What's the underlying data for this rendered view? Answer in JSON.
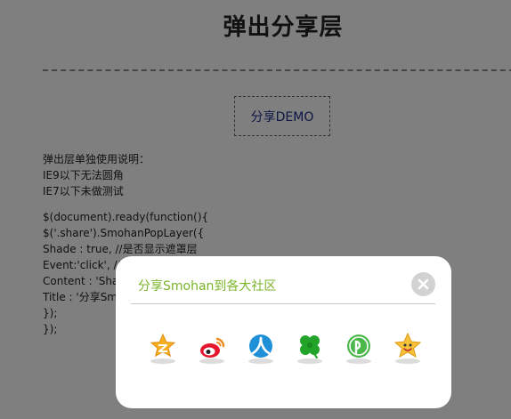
{
  "page": {
    "title": "弹出分享层",
    "demo_button_label": "分享DEMO"
  },
  "notes": [
    "弹出层单独使用说明：",
    "IE9以下无法圆角",
    "IE7以下未做测试"
  ],
  "code": [
    "$(document).ready(function(){",
    "$('.share').SmohanPopLayer({",
    "Shade : true, //是否显示遮罩层",
    "Event:'click', //",
    "Content : 'Sha",
    "Title : '分享Smo",
    "});",
    "});"
  ],
  "popup": {
    "title": "分享Smohan到各大社区",
    "icons": [
      {
        "name": "qzone-icon",
        "color": "#f5b021"
      },
      {
        "name": "sina-weibo-icon",
        "color": "#e6162d"
      },
      {
        "name": "renren-icon",
        "color": "#1f8fd8"
      },
      {
        "name": "kaixin-icon",
        "color": "#22a32a"
      },
      {
        "name": "pengyou-icon",
        "color": "#4cb84c"
      },
      {
        "name": "qq-star-icon",
        "color": "#f6c23a"
      }
    ]
  }
}
